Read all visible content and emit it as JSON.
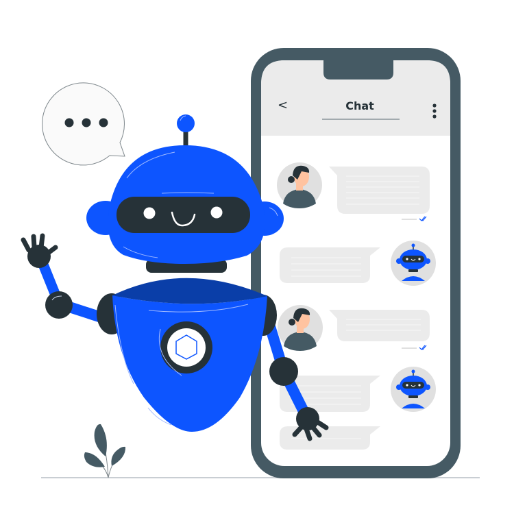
{
  "scene": {
    "description": "Chatbot illustration with waving robot and smartphone chat screen",
    "colors": {
      "robot_blue": "#0d55ff",
      "robot_blue_dark": "#0a3ea8",
      "robot_dark": "#263238",
      "phone_frame": "#455a64",
      "screen_bg": "#ffffff",
      "header_bg": "#ebebeb",
      "bubble_bg": "#ebebeb",
      "avatar_bg": "#e0e0e0",
      "skin": "#ffc3a0",
      "check_color": "#0d55ff"
    }
  },
  "phone": {
    "header": {
      "title": "Chat",
      "back_icon": "chevron-left-icon",
      "back_glyph": "<",
      "menu_icon": "more-vertical-icon"
    },
    "messages": [
      {
        "sender": "user",
        "avatar": "woman-avatar",
        "lines": 6,
        "read_receipt": true
      },
      {
        "sender": "bot",
        "avatar": "robot-avatar",
        "lines": 4,
        "read_receipt": false
      },
      {
        "sender": "user",
        "avatar": "woman-avatar",
        "lines": 3,
        "read_receipt": true
      },
      {
        "sender": "bot",
        "avatar": "robot-avatar",
        "lines": 4,
        "read_receipt": false
      },
      {
        "sender": "bot",
        "avatar": null,
        "lines": 1,
        "read_receipt": false
      }
    ]
  },
  "speech_bubble": {
    "icon": "typing-dots-icon",
    "dots": 3
  }
}
